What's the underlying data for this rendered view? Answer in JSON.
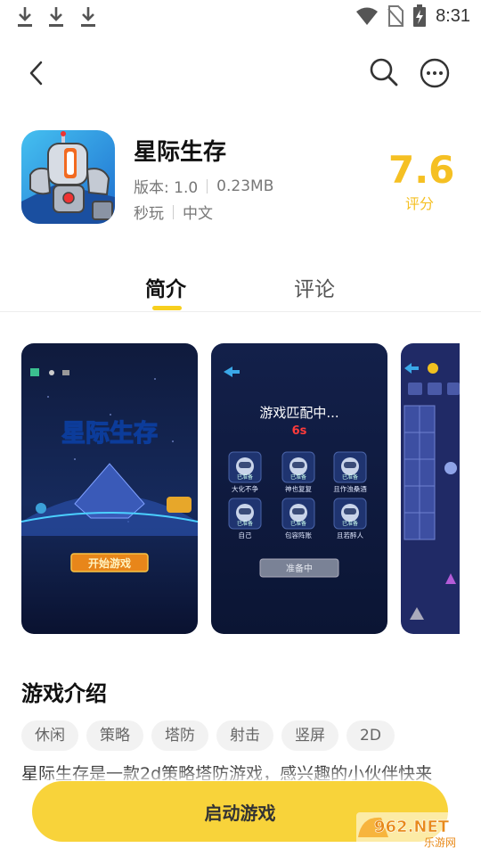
{
  "status_bar": {
    "time": "8:31",
    "icons": [
      "download-icon",
      "download-icon",
      "download-icon",
      "wifi-icon",
      "no-sim-icon",
      "battery-charging-icon"
    ]
  },
  "header": {
    "icons": [
      "back-arrow-icon",
      "search-icon",
      "more-options-icon"
    ]
  },
  "app": {
    "name": "星际生存",
    "version": "版本: 1.0",
    "size": "0.23MB",
    "category": "秒玩",
    "language": "中文",
    "rating": "7.6",
    "rating_label": "评分"
  },
  "tabs": [
    {
      "label": "简介",
      "active": true
    },
    {
      "label": "评论",
      "active": false
    }
  ],
  "screenshots": {
    "shot1": {
      "logo": "星际生存",
      "start": "开始游戏"
    },
    "shot2": {
      "title": "游戏匹配中...",
      "countdown": "6s",
      "players": [
        "大化不争",
        "神也复复",
        "且作浊桑酒",
        "自己",
        "包容阵账",
        "且若醉人"
      ],
      "status_tag": "已准备",
      "button": "准备中"
    }
  },
  "intro": {
    "title": "游戏介绍",
    "tags": [
      "休闲",
      "策略",
      "塔防",
      "射击",
      "竖屏",
      "2D"
    ],
    "description": "星际生存是一款2d策略塔防游戏，感兴趣的小伙伴快来"
  },
  "launch_button": "启动游戏",
  "watermark": {
    "brand": "962.NET",
    "site": "乐游网"
  },
  "colors": {
    "accent": "#f8d33a",
    "rating": "#f5c023"
  }
}
